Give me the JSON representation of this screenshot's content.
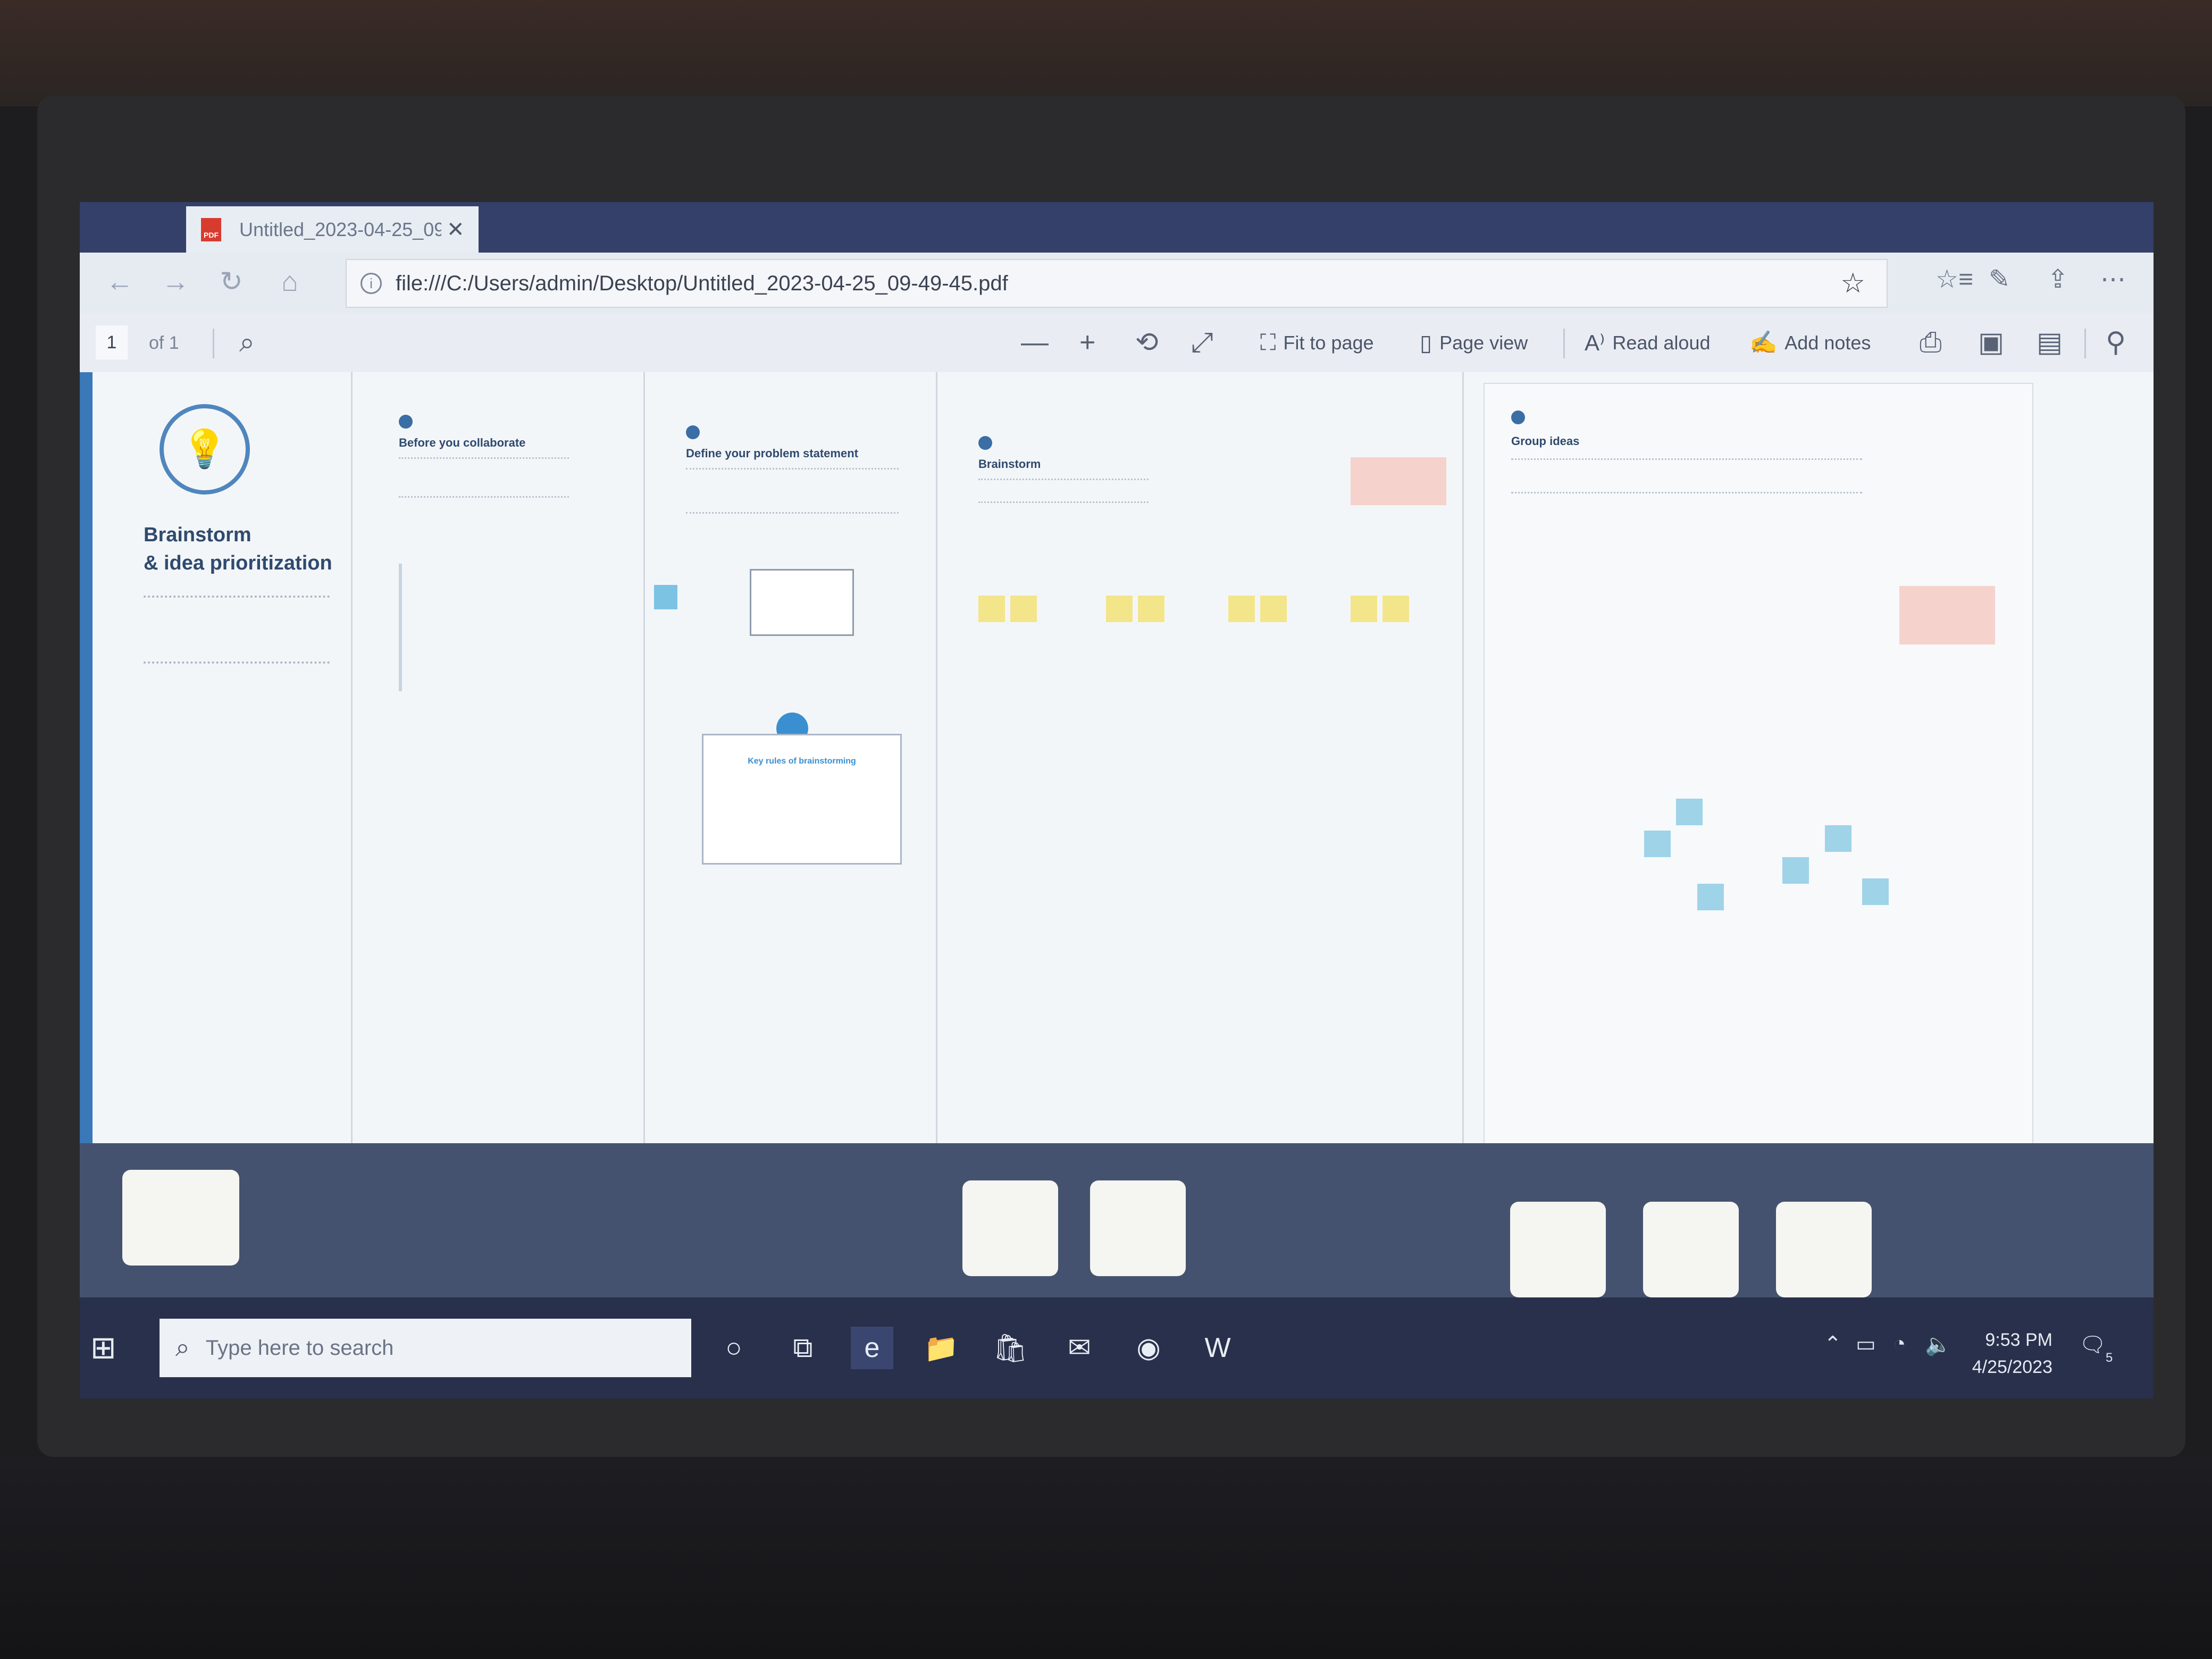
{
  "browser": {
    "tab_title": "Untitled_2023-04-25_09",
    "tab_icon": "pdf-icon",
    "url": "file:///C:/Users/admin/Desktop/Untitled_2023-04-25_09-49-45.pdf"
  },
  "pdf_toolbar": {
    "page_number": "1",
    "page_count": "of 1",
    "fit_to_page": "Fit to page",
    "page_view": "Page view",
    "read_aloud": "Read aloud",
    "add_notes": "Add notes"
  },
  "document": {
    "title_line1": "Brainstorm",
    "title_line2": "& idea prioritization",
    "sections": [
      {
        "title": "Before you collaborate"
      },
      {
        "title": "Define your problem statement"
      },
      {
        "title": "Brainstorm"
      },
      {
        "title": "Group ideas"
      }
    ],
    "key_rules": "Key rules of brainstorming"
  },
  "taskbar": {
    "search_placeholder": "Type here to search",
    "time": "9:53 PM",
    "date": "4/25/2023",
    "notification_count": "5"
  },
  "colors": {
    "accent": "#3a6ea5",
    "taskbar": "#28304c",
    "tabstrip": "#34406a",
    "pdf_red": "#d83b2e"
  }
}
